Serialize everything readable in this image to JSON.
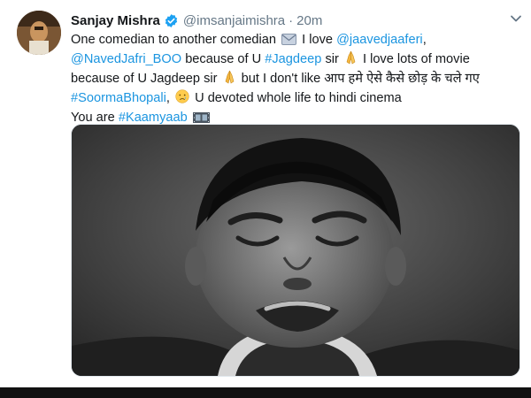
{
  "tweet": {
    "author_name": "Sanjay Mishra",
    "handle": "@imsanjaimishra",
    "separator": "·",
    "time": "20m",
    "text": {
      "l1_a": "One comedian to another comedian",
      "l1_b": "I love",
      "l1_mention": "@jaavedjaaferi",
      "l1_c": ",",
      "l2_mention": "@NavedJafri_BOO",
      "l2_a": "because of U",
      "l2_hashtag": "#Jagdeep",
      "l2_b": "sir",
      "l2_c": "I love lots of movie",
      "l3_a": "because of U Jagdeep sir",
      "l3_b": "but I don't like आप हमे ऐसे कैसे छोड़ के चले गए",
      "l4_hashtag": "#SoormaBhopali",
      "l4_a": ",",
      "l4_b": "U devoted whole life to hindi cinema",
      "l5_a": "You are",
      "l5_hashtag": "#Kaamyaab"
    }
  },
  "icons": {
    "verified": "verified-badge-icon",
    "menu": "chevron-down-icon",
    "envelope": "envelope-emoji",
    "pray": "folded-hands-emoji",
    "crying": "crying-face-emoji",
    "film": "film-frames-emoji"
  },
  "colors": {
    "link": "#1b95e0",
    "text": "#14171a",
    "secondary": "#657786",
    "verified": "#1da1f2"
  }
}
